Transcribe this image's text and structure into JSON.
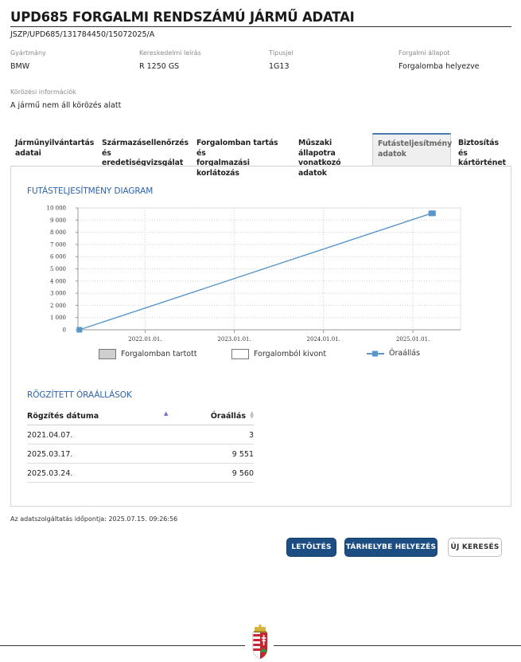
{
  "page": {
    "title": "UPD685 FORGALMI RENDSZÁMÚ JÁRMŰ ADATAI",
    "case_id": "JSZP/UPD685/131784450/15072025/A"
  },
  "fields": [
    {
      "label": "Gyártmány",
      "value": "BMW"
    },
    {
      "label": "Kereskedelmi leírás",
      "value": "R 1250 GS"
    },
    {
      "label": "Típusjel",
      "value": "1G13"
    },
    {
      "label": "Forgalmi állapot",
      "value": "Forgalomba helyezve"
    }
  ],
  "wanted": {
    "label": "Körözési információk",
    "value": "A jármű nem áll körözés alatt"
  },
  "tabs": [
    {
      "line1": "Járműnyilvántartás",
      "line2": "adatai",
      "active": false
    },
    {
      "line1": "Származásellenőrzés",
      "line2": "és eredetiségvizsgálat",
      "active": false
    },
    {
      "line1": "Forgalomban tartás és",
      "line2": "forgalmazási korlátozás",
      "active": false
    },
    {
      "line1": "Műszaki állapotra",
      "line2": "vonatkozó adatok",
      "active": false
    },
    {
      "line1": "Futásteljesítmény",
      "line2": "adatok",
      "active": true
    },
    {
      "line1": "Biztosítás és",
      "line2": "kártörténet",
      "active": false
    }
  ],
  "mileage": {
    "chart_title": "FUTÁSTELJESÍTMÉNY DIAGRAM",
    "legend": {
      "in_traffic": "Forgalomban tartott",
      "withdrawn": "Forgalomból kivont",
      "odometer": "Óraállás"
    },
    "table_title": "RÖGZÍTETT ÓRAÁLLÁSOK",
    "table_headers": {
      "date": "Rögzítés dátuma",
      "reading": "Óraállás"
    },
    "rows": [
      {
        "date": "2021.04.07.",
        "reading": "3"
      },
      {
        "date": "2025.03.17.",
        "reading": "9 551"
      },
      {
        "date": "2025.03.24.",
        "reading": "9 560"
      }
    ]
  },
  "chart_data": {
    "type": "line",
    "title": "FUTÁSTELJESÍTMÉNY DIAGRAM",
    "xlabel": "",
    "ylabel": "",
    "ylim": [
      0,
      10000
    ],
    "xlim": [
      "2021.04.01.",
      "2025.07.15."
    ],
    "yticks": [
      0,
      1000,
      2000,
      3000,
      4000,
      5000,
      6000,
      7000,
      8000,
      9000,
      10000
    ],
    "ytick_labels": [
      "0",
      "1 000",
      "2 000",
      "3 000",
      "4 000",
      "5 000",
      "6 000",
      "7 000",
      "8 000",
      "9 000",
      "10 000"
    ],
    "xticks": [
      "2022.01.01.",
      "2023.01.01.",
      "2024.01.01.",
      "2025.01.01."
    ],
    "series": [
      {
        "name": "Óraállás",
        "x": [
          "2021.04.07.",
          "2025.03.17.",
          "2025.03.24."
        ],
        "values": [
          3,
          9551,
          9560
        ],
        "color": "#5b96c9"
      }
    ],
    "grid": true,
    "legend_position": "bottom"
  },
  "footer": {
    "timestamp": "Az adatszolgáltatás időpontja: 2025.07.15. 09:26:56"
  },
  "buttons": {
    "download": "LETÖLTÉS",
    "store": "TÁRHELYBE HELYEZÉS",
    "new_search": "ÚJ KERESÉS"
  },
  "colors": {
    "primary_button": "#1c4e84",
    "section_title": "#2f63a8",
    "series": "#5b96c9"
  }
}
